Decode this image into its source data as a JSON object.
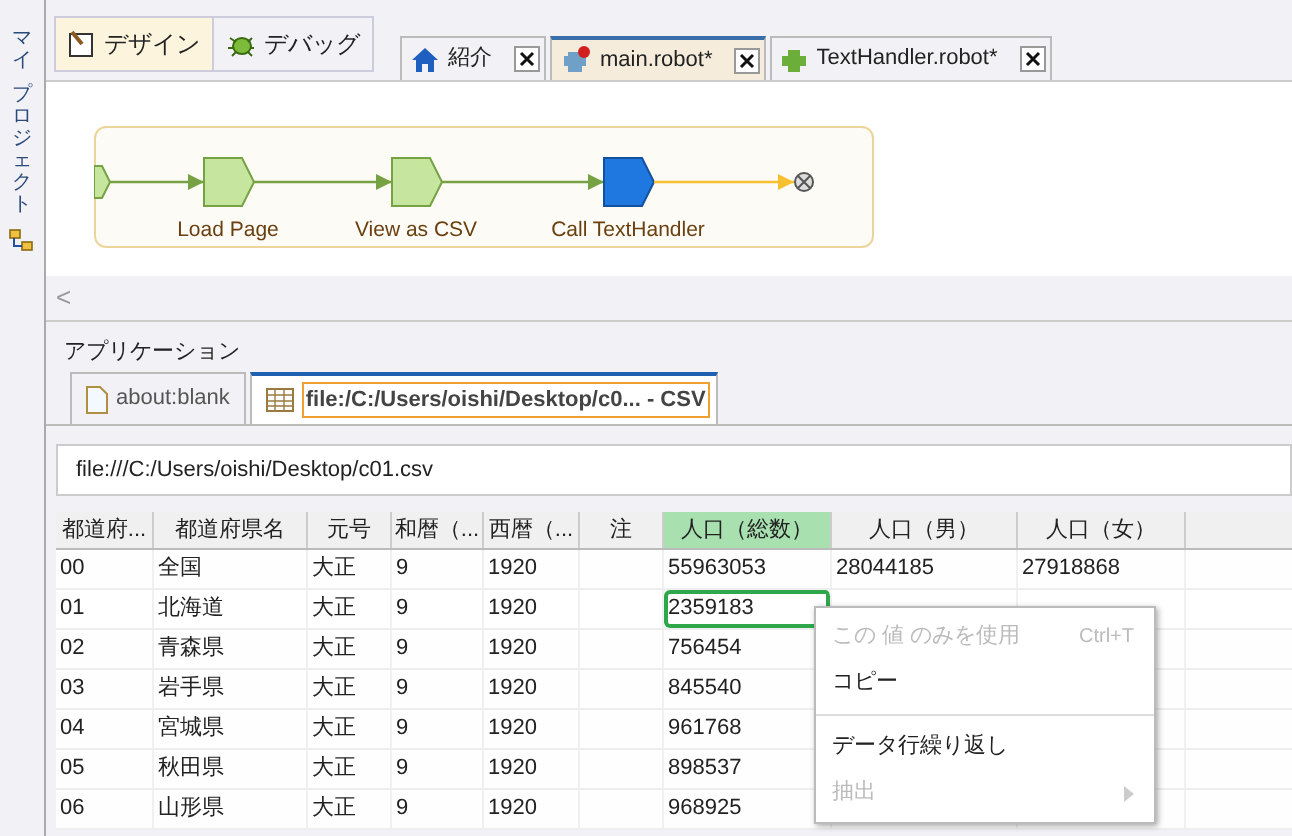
{
  "side_panel": {
    "titles": [
      "マイ",
      "プロジェクト"
    ]
  },
  "mode_buttons": [
    {
      "label": "デザイン",
      "kind": "design",
      "selected": true
    },
    {
      "label": "デバッグ",
      "kind": "debug",
      "selected": false
    }
  ],
  "editor_tabs": [
    {
      "label": "紹介",
      "kind": "home",
      "selected": false
    },
    {
      "label": "main.robot*",
      "kind": "robot",
      "selected": true
    },
    {
      "label": "TextHandler.robot*",
      "kind": "robot2",
      "selected": false
    }
  ],
  "flow": {
    "steps": [
      {
        "kind": "start"
      },
      {
        "kind": "step",
        "label": "Load Page"
      },
      {
        "kind": "step",
        "label": "View as CSV"
      },
      {
        "kind": "call",
        "label": "Call TextHandler"
      },
      {
        "kind": "end"
      }
    ]
  },
  "collapse": {
    "label": "<"
  },
  "section_title": "アプリケーション",
  "app_tabs": [
    {
      "label": "about:blank",
      "kind": "page",
      "selected": false
    },
    {
      "label": "file:/C:/Users/oishi/Desktop/c0... - CSV",
      "kind": "table",
      "selected": true
    }
  ],
  "url": "file:///C:/Users/oishi/Desktop/c01.csv",
  "table": {
    "columns": [
      {
        "label": "都道府...",
        "selected": false
      },
      {
        "label": "都道府県名",
        "selected": false
      },
      {
        "label": "元号",
        "selected": false
      },
      {
        "label": "和暦（...",
        "selected": false
      },
      {
        "label": "西暦（...",
        "selected": false
      },
      {
        "label": "注",
        "selected": false
      },
      {
        "label": "人口（総数）",
        "selected": true
      },
      {
        "label": "人口（男）",
        "selected": false
      },
      {
        "label": "人口（女）",
        "selected": false
      }
    ],
    "rows": [
      {
        "cells": [
          "00",
          "全国",
          "大正",
          "9",
          "1920",
          "",
          "55963053",
          "28044185",
          "27918868"
        ],
        "selected": false
      },
      {
        "cells": [
          "01",
          "北海道",
          "大正",
          "9",
          "1920",
          "",
          "2359183"
        ],
        "selected": true
      },
      {
        "cells": [
          "02",
          "青森県",
          "大正",
          "9",
          "1920",
          "",
          "756454"
        ],
        "selected": false
      },
      {
        "cells": [
          "03",
          "岩手県",
          "大正",
          "9",
          "1920",
          "",
          "845540"
        ],
        "selected": false
      },
      {
        "cells": [
          "04",
          "宮城県",
          "大正",
          "9",
          "1920",
          "",
          "961768"
        ],
        "selected": false
      },
      {
        "cells": [
          "05",
          "秋田県",
          "大正",
          "9",
          "1920",
          "",
          "898537"
        ],
        "selected": false
      },
      {
        "cells": [
          "06",
          "山形県",
          "大正",
          "9",
          "1920",
          "",
          "968925"
        ],
        "selected": false
      }
    ]
  },
  "context_menu": [
    {
      "label": "この 値 のみを使用",
      "shortcut": "Ctrl+T",
      "disabled": true,
      "kind": "item"
    },
    {
      "label": "コピー",
      "disabled": false,
      "kind": "item"
    },
    {
      "kind": "separator"
    },
    {
      "label": "データ行繰り返し",
      "disabled": false,
      "kind": "item"
    },
    {
      "label": "抽出",
      "disabled": true,
      "kind": "submenu"
    }
  ]
}
